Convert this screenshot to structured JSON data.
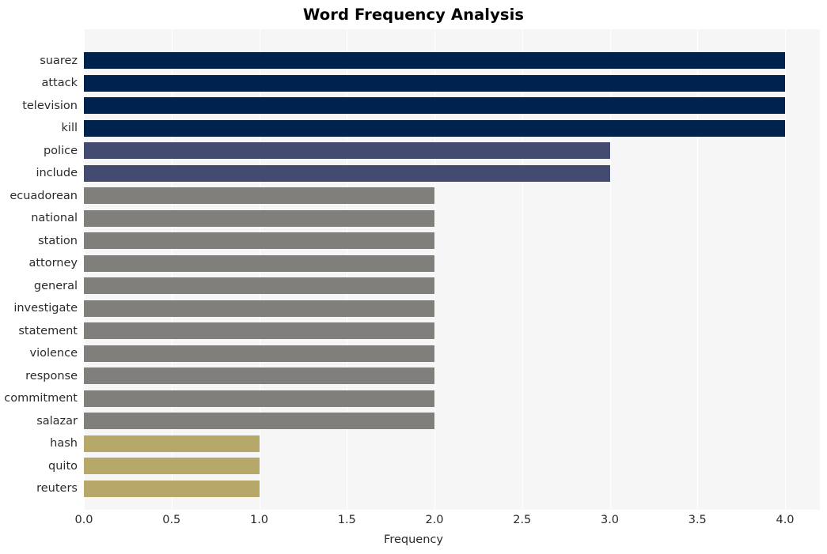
{
  "chart_data": {
    "type": "bar",
    "orientation": "horizontal",
    "title": "Word Frequency Analysis",
    "xlabel": "Frequency",
    "ylabel": "",
    "xlim": [
      0.0,
      4.0
    ],
    "xticks": [
      "0.0",
      "0.5",
      "1.0",
      "1.5",
      "2.0",
      "2.5",
      "3.0",
      "3.5",
      "4.0"
    ],
    "xtick_values": [
      0.0,
      0.5,
      1.0,
      1.5,
      2.0,
      2.5,
      3.0,
      3.5,
      4.0
    ],
    "grid": true,
    "grid_axis": "x",
    "legend": "none",
    "categories": [
      "suarez",
      "attack",
      "television",
      "kill",
      "police",
      "include",
      "ecuadorean",
      "national",
      "station",
      "attorney",
      "general",
      "investigate",
      "statement",
      "violence",
      "response",
      "commitment",
      "salazar",
      "hash",
      "quito",
      "reuters"
    ],
    "values": [
      4,
      4,
      4,
      4,
      3,
      3,
      2,
      2,
      2,
      2,
      2,
      2,
      2,
      2,
      2,
      2,
      2,
      1,
      1,
      1
    ],
    "bar_colors": [
      "#00234e",
      "#00234e",
      "#00234e",
      "#00234e",
      "#434c70",
      "#434c70",
      "#807f7c",
      "#807f7c",
      "#807f7c",
      "#807f7c",
      "#807f7c",
      "#807f7c",
      "#807f7c",
      "#807f7c",
      "#807f7c",
      "#807f7c",
      "#807f7c",
      "#b5a868",
      "#b5a868",
      "#b5a868"
    ],
    "palette": {
      "navy": "#00234e",
      "slate": "#434c70",
      "gray": "#807f7c",
      "khaki": "#b5a868",
      "plot_background": "#f6f6f7",
      "grid": "#ffffff",
      "text": "#2b2b2b",
      "figure_background": "#ffffff"
    }
  }
}
